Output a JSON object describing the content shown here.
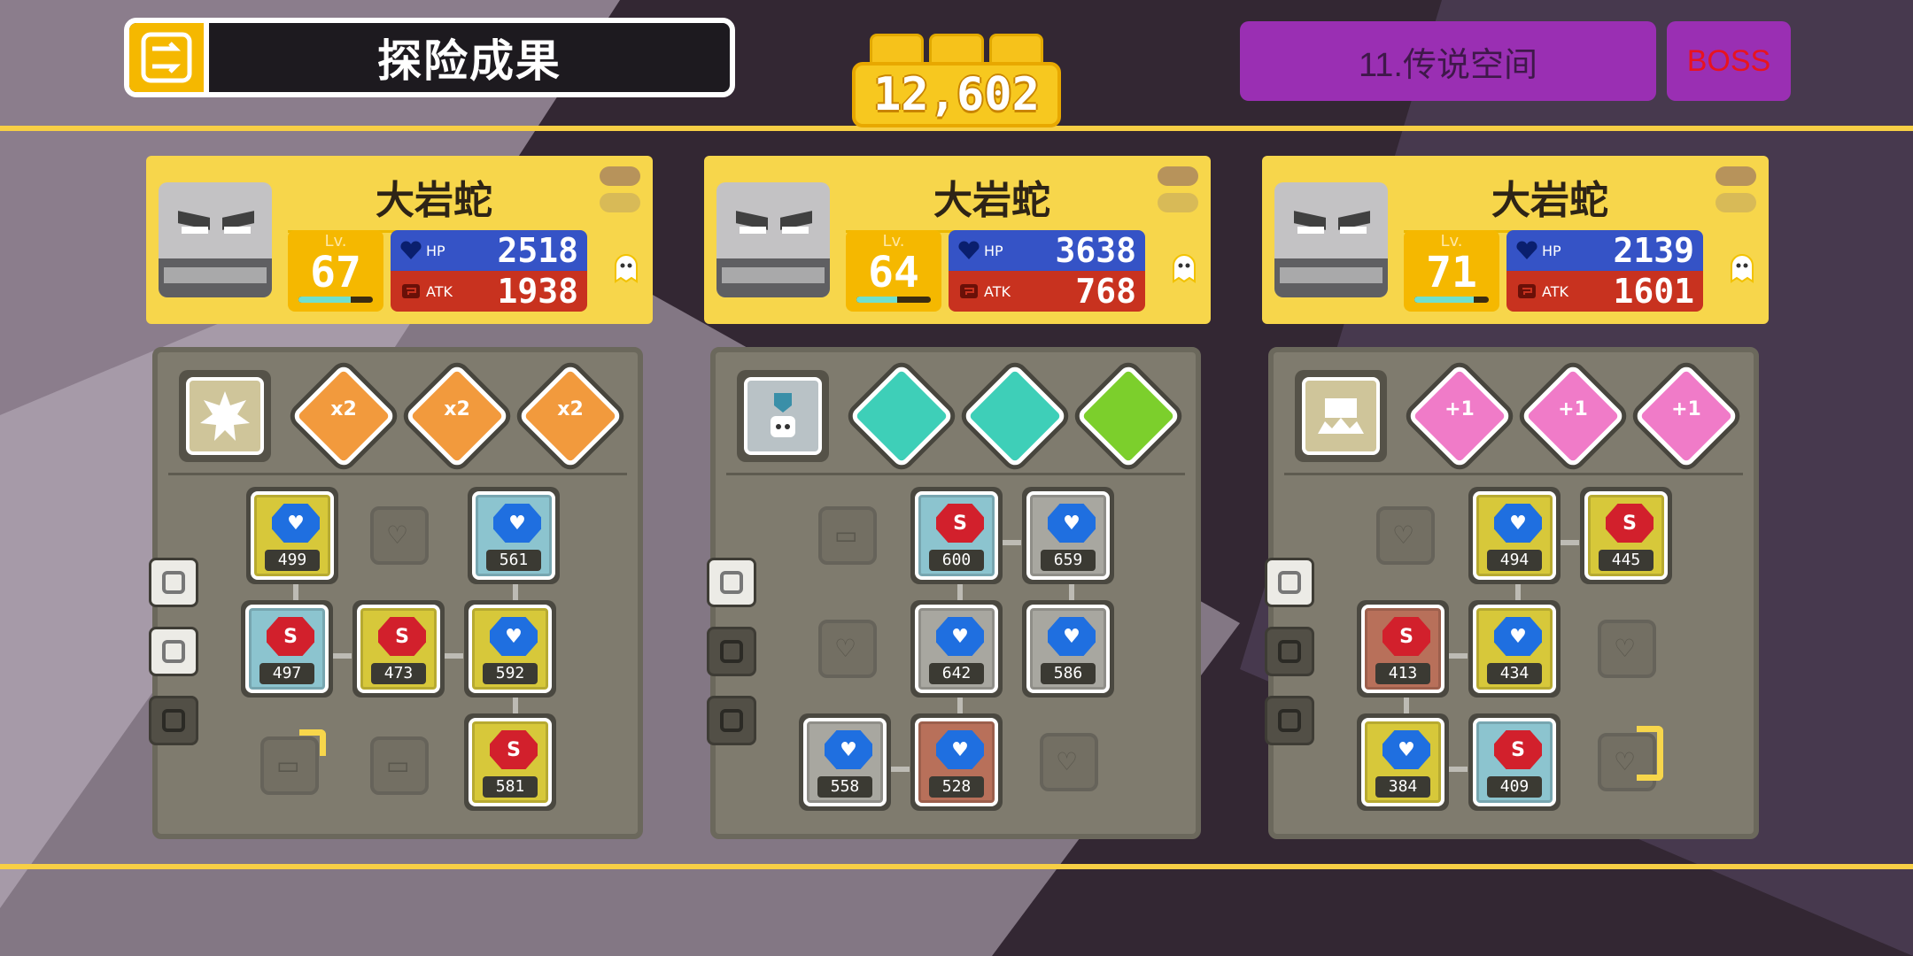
{
  "header": {
    "title": "探险成果",
    "title_icon": "bb-swap-icon",
    "coin_count": "12,602",
    "stage_label": "11.传说空间",
    "boss_label": "BOSS"
  },
  "colors": {
    "band": "#f7cf45",
    "card_bg": "#f7d64b",
    "stage_purple": "#9a2fb3",
    "boss_text": "#e8131f",
    "hp_blue": "#3553c6",
    "atk_red": "#c8321f"
  },
  "monsters": [
    {
      "name": "大岩蛇",
      "level_label": "Lv.",
      "level": "67",
      "level_progress": 0.7,
      "hp_label": "HP",
      "hp": "2518",
      "atk_label": "ATK",
      "atk": "1938",
      "skill_icon": "spiky-burst-icon",
      "bingo_icons": [
        "double-attack-x2-icon",
        "double-attack-x2-icon",
        "double-attack-x2-icon"
      ],
      "bingo_labels": [
        "x2",
        "x2",
        "x2"
      ],
      "stones": [
        "499",
        "561",
        "497",
        "473",
        "592",
        "581"
      ]
    },
    {
      "name": "大岩蛇",
      "level_label": "Lv.",
      "level": "64",
      "level_progress": 0.55,
      "hp_label": "HP",
      "hp": "3638",
      "atk_label": "ATK",
      "atk": "768",
      "skill_icon": "shield-robot-icon",
      "bingo_icons": [
        "teal-defense-icon",
        "teal-defense-icon",
        "green-defense-icon"
      ],
      "bingo_labels": [
        "",
        "",
        ""
      ],
      "stones": [
        "600",
        "659",
        "642",
        "586",
        "558",
        "528"
      ]
    },
    {
      "name": "大岩蛇",
      "level_label": "Lv.",
      "level": "71",
      "level_progress": 0.8,
      "hp_label": "HP",
      "hp": "2139",
      "atk_label": "ATK",
      "atk": "1601",
      "skill_icon": "block-burst-icon",
      "bingo_icons": [
        "pink-arrow-plus1-icon",
        "pink-arrow-plus1-icon",
        "pink-arrow-plus1-icon"
      ],
      "bingo_labels": [
        "+1",
        "+1",
        "+1"
      ],
      "stones": [
        "494",
        "445",
        "413",
        "434",
        "384",
        "409"
      ]
    }
  ]
}
